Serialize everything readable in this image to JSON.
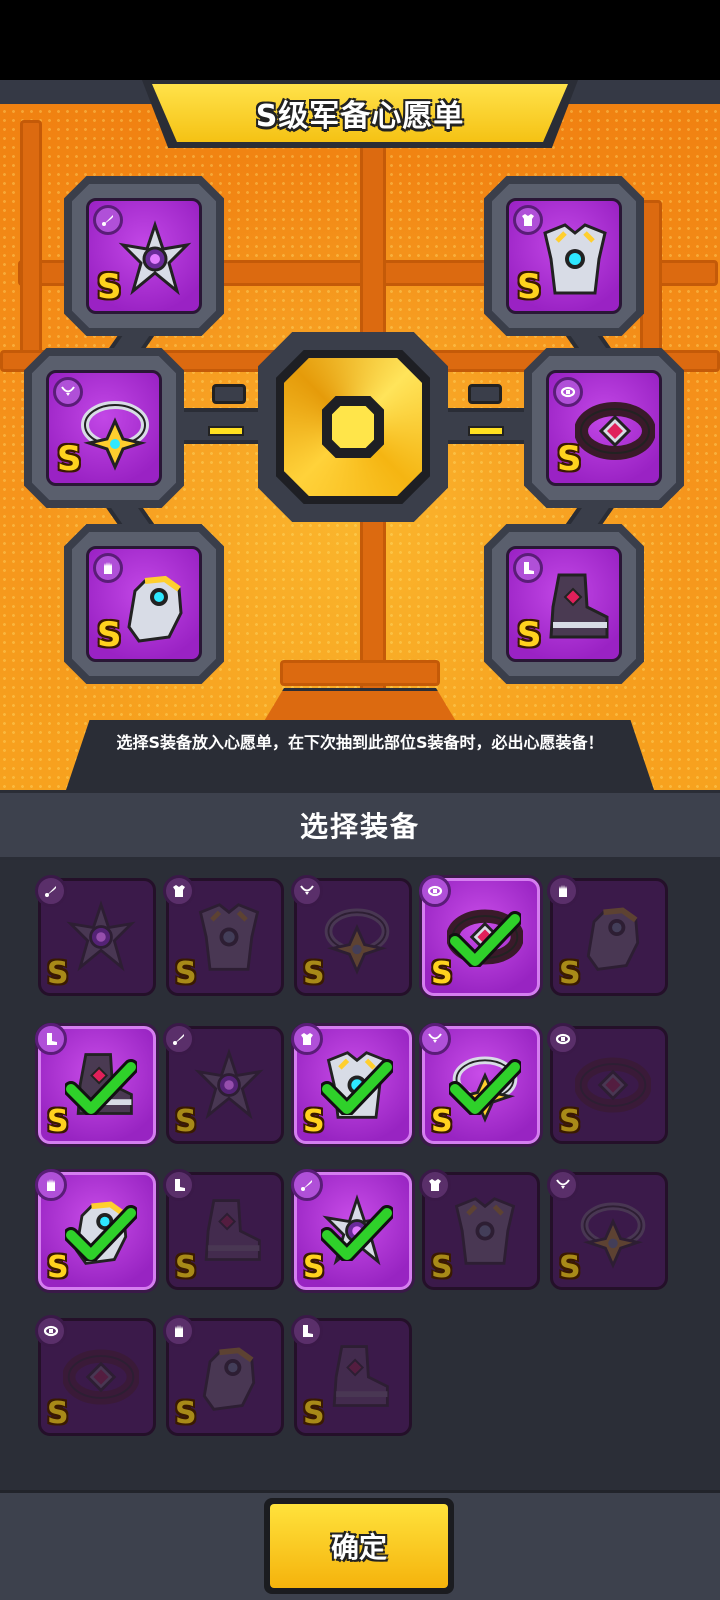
{
  "wishlist": {
    "title": "S级军备心愿单",
    "hint": "选择S装备放入心愿单，在下次抽到此部位S装备时，必出心愿装备！",
    "slots": [
      {
        "slot": "weapon",
        "icon": "weapon-icon",
        "grade": "S",
        "item": "spiked-orb-blade"
      },
      {
        "slot": "armor",
        "icon": "armor-icon",
        "grade": "S",
        "item": "cyber-chestplate"
      },
      {
        "slot": "necklace",
        "icon": "necklace-icon",
        "grade": "S",
        "item": "star-ring"
      },
      {
        "slot": "belt",
        "icon": "belt-icon",
        "grade": "S",
        "item": "crimson-belt"
      },
      {
        "slot": "gloves",
        "icon": "glove-icon",
        "grade": "S",
        "item": "gold-gauntlet"
      },
      {
        "slot": "boots",
        "icon": "boot-icon",
        "grade": "S",
        "item": "ruby-boots"
      }
    ]
  },
  "selection": {
    "title": "选择装备",
    "items": [
      {
        "icon": "weapon-icon",
        "grade": "S",
        "selected": false
      },
      {
        "icon": "armor-icon",
        "grade": "S",
        "selected": false
      },
      {
        "icon": "necklace-icon",
        "grade": "S",
        "selected": false
      },
      {
        "icon": "belt-icon",
        "grade": "S",
        "selected": true
      },
      {
        "icon": "glove-icon",
        "grade": "S",
        "selected": false
      },
      {
        "icon": "boot-icon",
        "grade": "S",
        "selected": true
      },
      {
        "icon": "weapon-icon",
        "grade": "S",
        "selected": false
      },
      {
        "icon": "armor-icon",
        "grade": "S",
        "selected": true
      },
      {
        "icon": "necklace-icon",
        "grade": "S",
        "selected": true
      },
      {
        "icon": "belt-icon",
        "grade": "S",
        "selected": false
      },
      {
        "icon": "glove-icon",
        "grade": "S",
        "selected": true
      },
      {
        "icon": "boot-icon",
        "grade": "S",
        "selected": false
      },
      {
        "icon": "weapon-icon",
        "grade": "S",
        "selected": true
      },
      {
        "icon": "armor-icon",
        "grade": "S",
        "selected": false
      },
      {
        "icon": "necklace-icon",
        "grade": "S",
        "selected": false
      },
      {
        "icon": "belt-icon",
        "grade": "S",
        "selected": false
      },
      {
        "icon": "glove-icon",
        "grade": "S",
        "selected": false
      },
      {
        "icon": "boot-icon",
        "grade": "S",
        "selected": false
      }
    ]
  },
  "actions": {
    "confirm_label": "确定"
  },
  "colors": {
    "panel_orange": "#f5901a",
    "card_purple": "#a92ed2",
    "grade_gold": "#ffd21e",
    "check_green": "#2fd12a",
    "confirm_yellow": "#f5c214"
  }
}
